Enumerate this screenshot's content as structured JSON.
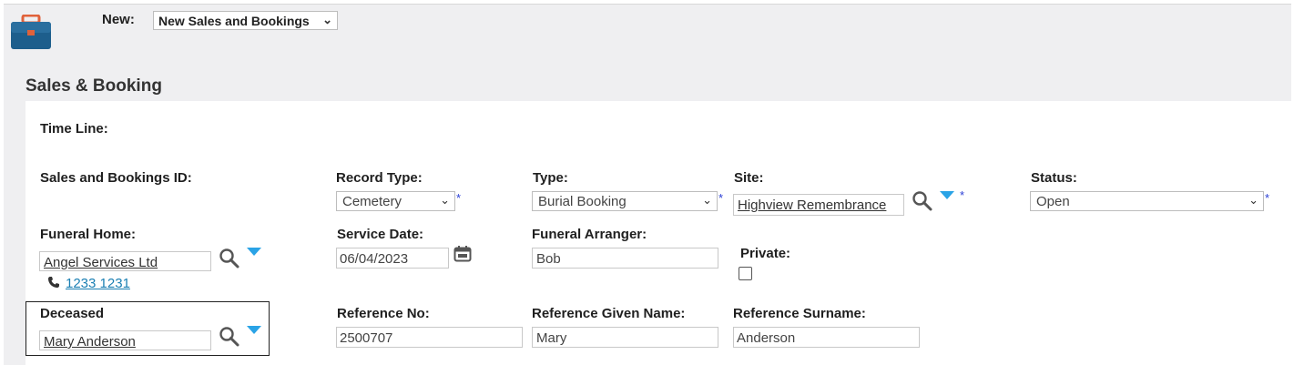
{
  "header": {
    "new_label": "New:",
    "new_select_value": "New Sales and Bookings",
    "section_title": "Sales & Booking"
  },
  "form": {
    "timeline_label": "Time Line:",
    "sales_id_label": "Sales and Bookings ID:",
    "record_type_label": "Record Type:",
    "record_type_value": "Cemetery",
    "type_label": "Type:",
    "type_value": "Burial Booking",
    "site_label": "Site:",
    "site_value": "Highview Remembrance",
    "status_label": "Status:",
    "status_value": "Open",
    "funeral_home_label": "Funeral Home:",
    "funeral_home_value": "Angel Services Ltd",
    "funeral_home_phone": "1233 1231",
    "service_date_label": "Service Date:",
    "service_date_value": "06/04/2023",
    "funeral_arranger_label": "Funeral Arranger:",
    "funeral_arranger_value": "Bob",
    "private_label": "Private:",
    "deceased_label": "Deceased",
    "deceased_value": "Mary Anderson",
    "reference_no_label": "Reference No:",
    "reference_no_value": "2500707",
    "reference_given_name_label": "Reference Given Name:",
    "reference_given_name_value": "Mary",
    "reference_surname_label": "Reference Surname:",
    "reference_surname_value": "Anderson",
    "required_mark": "*"
  },
  "icons": {
    "app": "briefcase-icon",
    "search": "magnifier-icon",
    "dropdown": "blue-triangle-icon",
    "calendar": "calendar-icon",
    "phone": "phone-icon"
  },
  "colors": {
    "background_gray": "#efeff1",
    "accent_blue": "#2aa3e6",
    "required_blue": "#2b3fd6",
    "link_teal": "#1a7fb3",
    "briefcase_blue": "#1d5e8c",
    "briefcase_orange": "#e0623b"
  }
}
